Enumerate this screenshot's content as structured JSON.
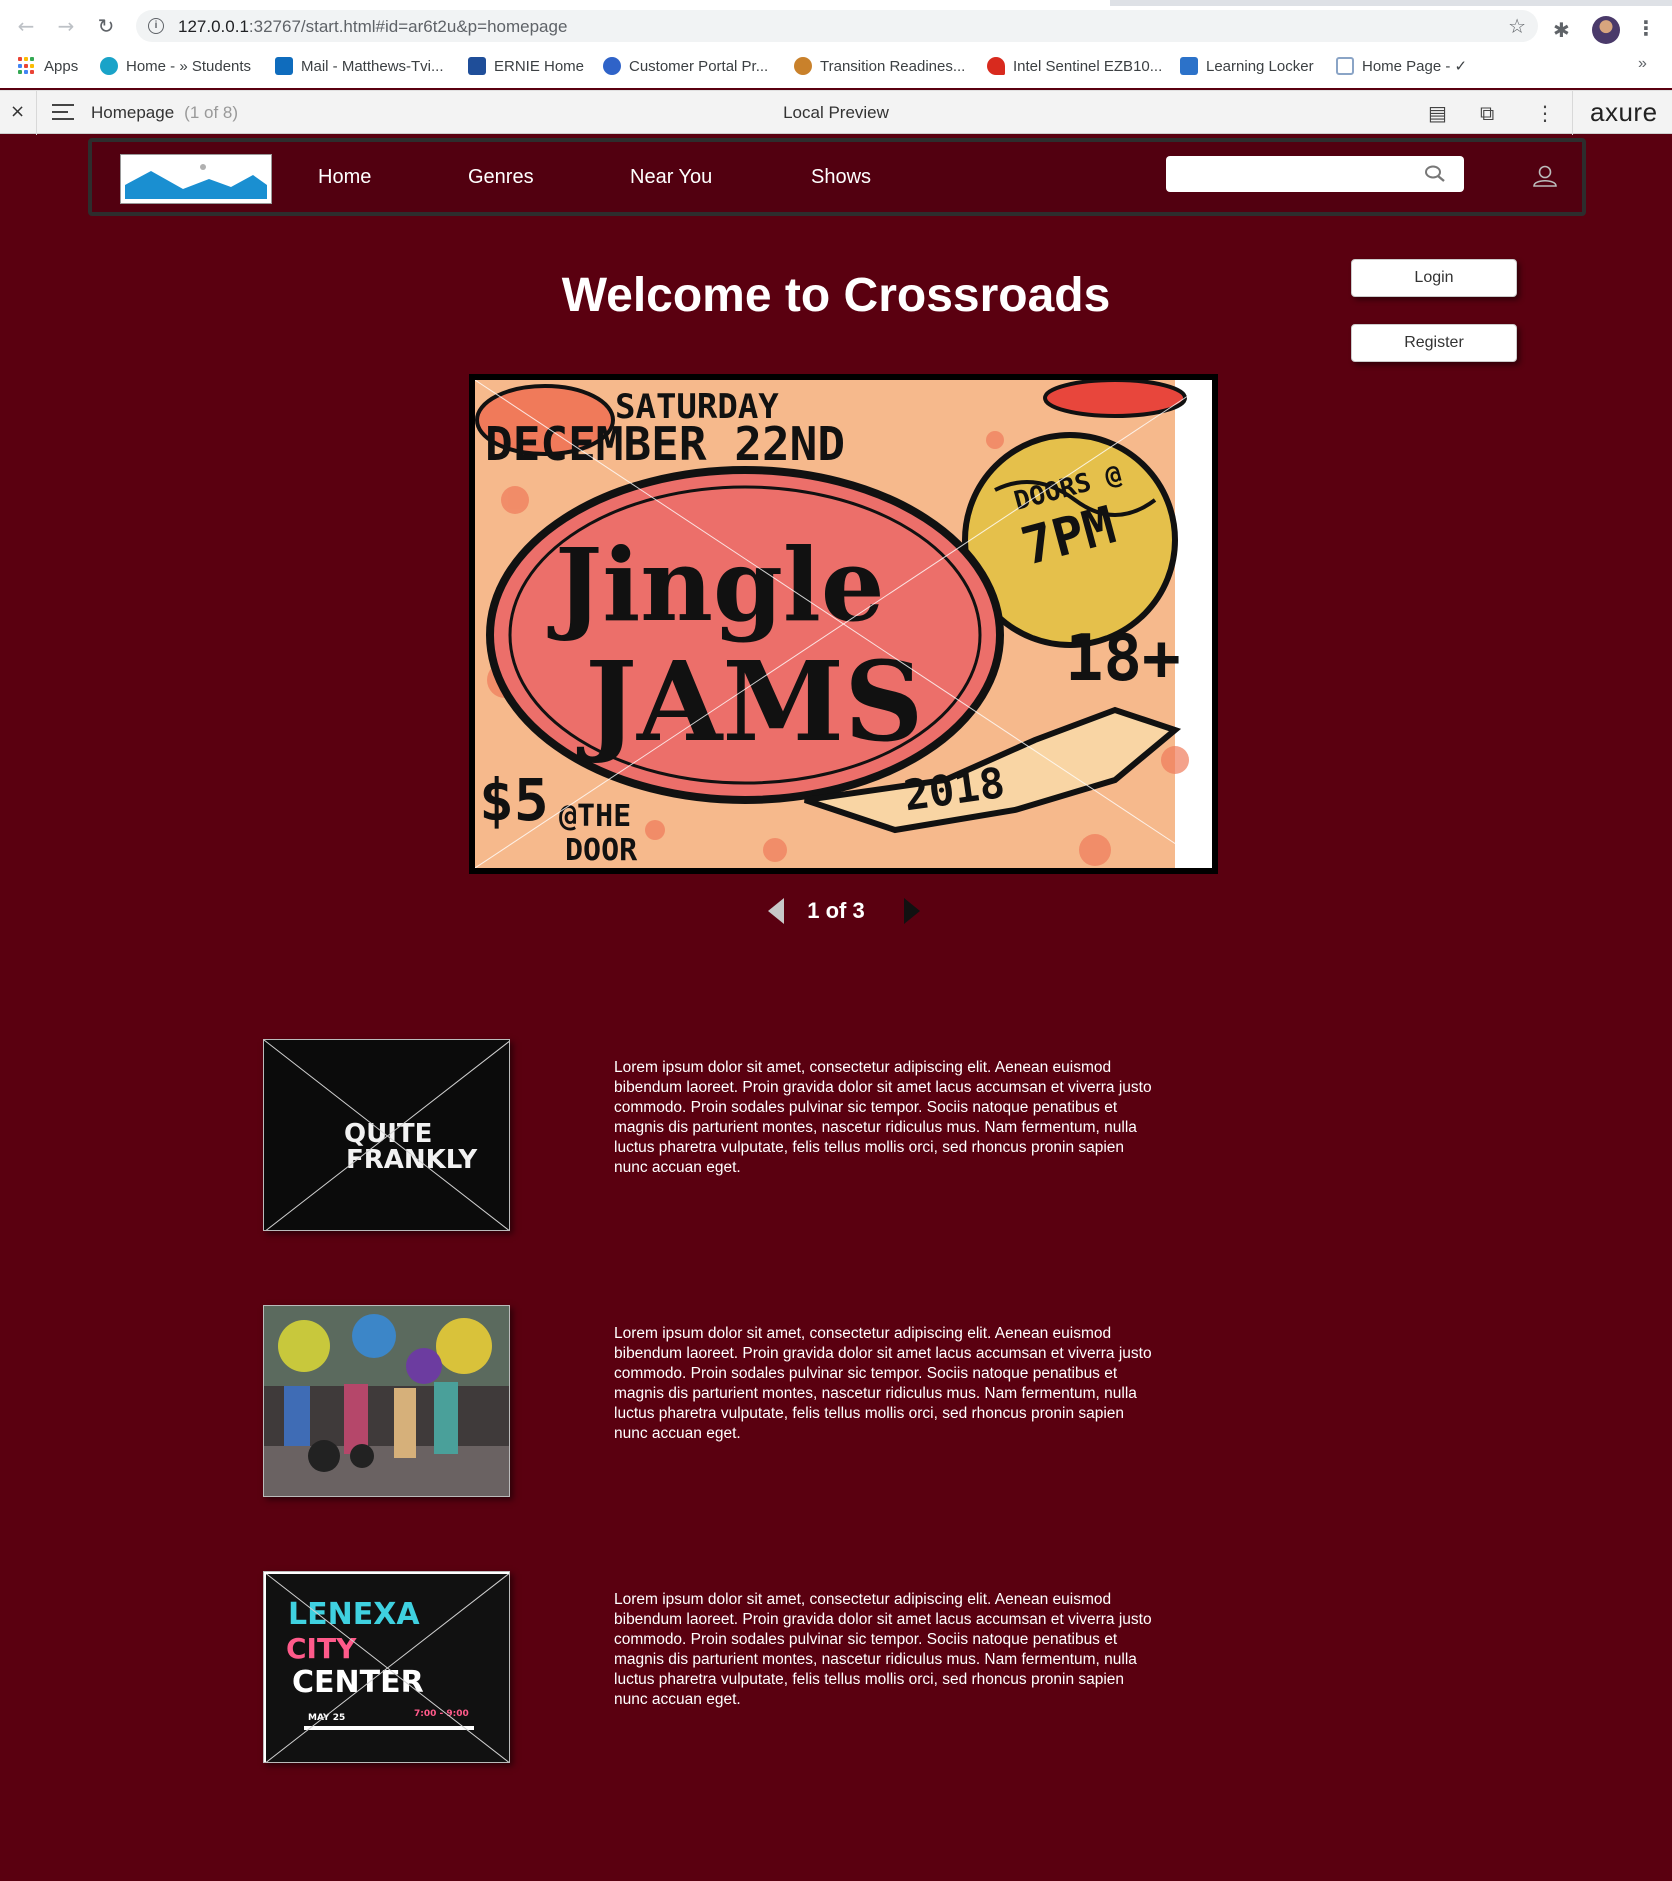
{
  "browser": {
    "url_prefix": "127.0.0.1",
    "url_rest": ":32767/start.html#id=ar6t2u&p=homepage",
    "bookmarks": [
      {
        "label": "Apps",
        "color": "#ea4335"
      },
      {
        "label": "Home - » Students",
        "color": "#1aa3c8"
      },
      {
        "label": "Mail - Matthews-Tvi...",
        "color": "#0f6cbd"
      },
      {
        "label": "ERNIE Home",
        "color": "#1f4e99"
      },
      {
        "label": "Customer Portal Pr...",
        "color": "#2f63c8"
      },
      {
        "label": "Transition Readines...",
        "color": "#c9812b"
      },
      {
        "label": "Intel Sentinel EZB10...",
        "color": "#d82a1e"
      },
      {
        "label": "Learning Locker",
        "color": "#2c72c9"
      },
      {
        "label": "Home Page - ✓",
        "color": "#8aa4c6"
      }
    ],
    "more_chevron": "»"
  },
  "axure": {
    "close": "×",
    "page_name": "Homepage",
    "page_count": "(1 of 8)",
    "title": "Local Preview",
    "logo": "axure"
  },
  "site": {
    "nav": [
      "Home",
      "Genres",
      "Near You",
      "Shows"
    ],
    "search_placeholder": "",
    "welcome": "Welcome to Crossroads",
    "login": "Login",
    "register": "Register",
    "slideshow": {
      "counter": "1 of 3",
      "poster": {
        "day": "SATURDAY",
        "date": "DECEMBER 22ND",
        "doors": "DOORS @",
        "time": "7PM",
        "title_top": "Jingle",
        "title_bottom": "JAMS",
        "year": "2018",
        "age": "18+",
        "price": "$5",
        "at": "@THE",
        "door": "DOOR"
      }
    },
    "features": [
      {
        "thumb_text": [
          "QUITE",
          "FRANKLY"
        ],
        "text": "Lorem ipsum dolor sit amet, consectetur adipiscing elit. Aenean euismod bibendum laoreet. Proin gravida dolor sit amet lacus accumsan et viverra justo commodo. Proin sodales pulvinar sic tempor. Sociis natoque penatibus et magnis dis parturient montes, nascetur ridiculus mus. Nam fermentum, nulla luctus pharetra vulputate, felis tellus mollis orci, sed rhoncus pronin sapien nunc accuan eget."
      },
      {
        "thumb_text": [],
        "text": "Lorem ipsum dolor sit amet, consectetur adipiscing elit. Aenean euismod bibendum laoreet. Proin gravida dolor sit amet lacus accumsan et viverra justo commodo. Proin sodales pulvinar sic tempor. Sociis natoque penatibus et magnis dis parturient montes, nascetur ridiculus mus. Nam fermentum, nulla luctus pharetra vulputate, felis tellus mollis orci, sed rhoncus pronin sapien nunc accuan eget."
      },
      {
        "thumb_text": [
          "LENEXA",
          "CITY",
          "CENTER",
          "MAY 25",
          "7:00 - 9:00"
        ],
        "text": "Lorem ipsum dolor sit amet, consectetur adipiscing elit. Aenean euismod bibendum laoreet. Proin gravida dolor sit amet lacus accumsan et viverra justo commodo. Proin sodales pulvinar sic tempor. Sociis natoque penatibus et magnis dis parturient montes, nascetur ridiculus mus. Nam fermentum, nulla luctus pharetra vulputate, felis tellus mollis orci, sed rhoncus pronin sapien nunc accuan eget."
      }
    ]
  },
  "colors": {
    "page_bg": "#5a0010",
    "header_bg": "#520010",
    "logo_blue": "#1a8fd1"
  },
  "icons": [
    "back-icon",
    "forward-icon",
    "reload-icon",
    "info-icon",
    "star-icon",
    "extensions-icon",
    "menu-icon",
    "search-icon",
    "user-icon",
    "sitemap-icon",
    "inspect-icon"
  ]
}
